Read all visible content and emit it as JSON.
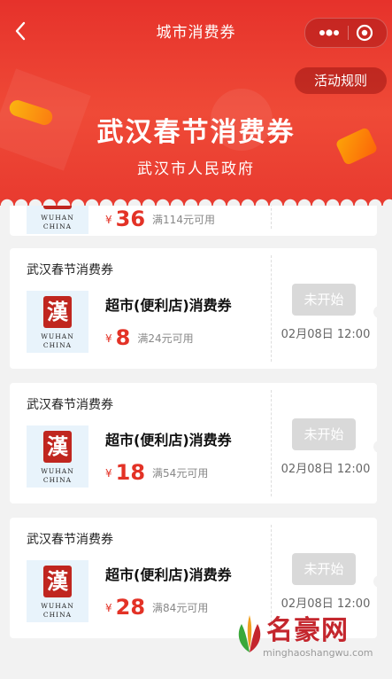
{
  "navbar": {
    "back_icon": "chevron-left-icon",
    "title": "城市消费券",
    "more_icon": "more-dots-icon",
    "close_icon": "target-close-icon"
  },
  "header": {
    "rules_label": "活动规则",
    "title": "武汉春节消费券",
    "subtitle": "武汉市人民政府",
    "bg_color": "#e6322b"
  },
  "logo": {
    "seal_char": "漢",
    "line1": "WUHAN",
    "line2": "CHINA"
  },
  "coupons": [
    {
      "issuer": "",
      "name": "",
      "currency": "¥",
      "amount": "36",
      "condition": "满114元可用",
      "status": "",
      "start": ""
    },
    {
      "issuer": "武汉春节消费券",
      "name": "超市(便利店)消费券",
      "currency": "¥",
      "amount": "8",
      "condition": "满24元可用",
      "status": "未开始",
      "start": "02月08日 12:00"
    },
    {
      "issuer": "武汉春节消费券",
      "name": "超市(便利店)消费券",
      "currency": "¥",
      "amount": "18",
      "condition": "满54元可用",
      "status": "未开始",
      "start": "02月08日 12:00"
    },
    {
      "issuer": "武汉春节消费券",
      "name": "超市(便利店)消费券",
      "currency": "¥",
      "amount": "28",
      "condition": "满84元可用",
      "status": "未开始",
      "start": "02月08日 12:00"
    }
  ],
  "watermark": {
    "brand": "名豪网",
    "url": "minghaoshangwu.com"
  },
  "colors": {
    "accent_red": "#e33226",
    "disabled_button": "#d9d9d9"
  }
}
